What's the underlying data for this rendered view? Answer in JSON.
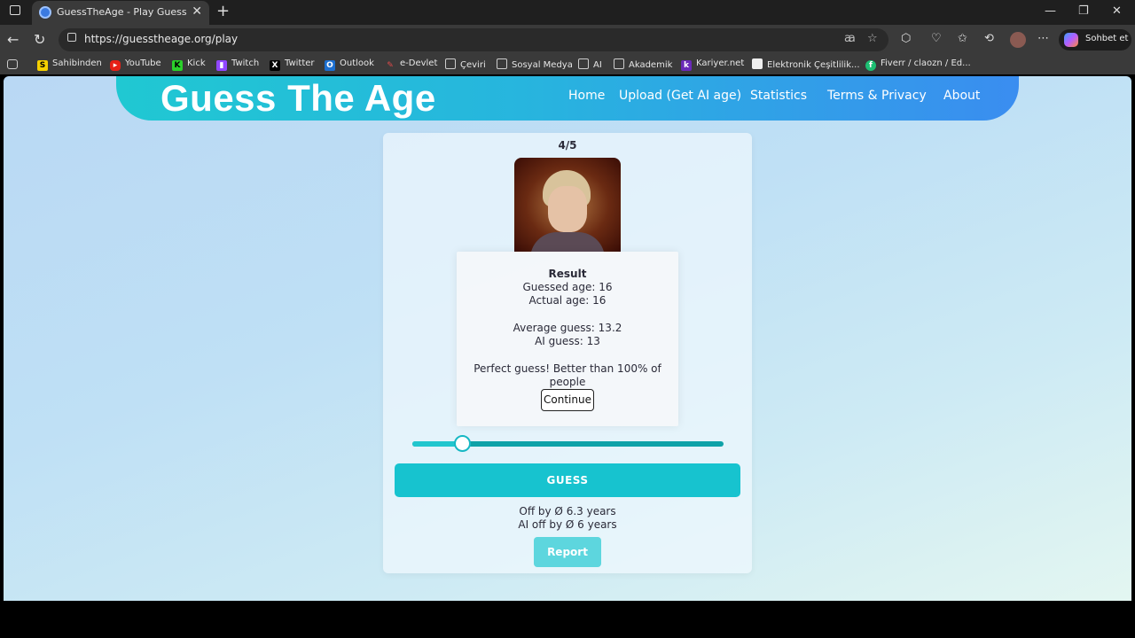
{
  "browser": {
    "tab_title": "GuessTheAge - Play Guess The Ag",
    "url": "https://guesstheage.org/play",
    "copilot_label": "Sohbet et",
    "bookmarks": [
      "Sahibinden",
      "YouTube",
      "Kick",
      "Twitch",
      "Twitter",
      "Outlook",
      "e-Devlet",
      "Çeviri",
      "Sosyal Medya",
      "AI",
      "Akademik",
      "Kariyer.net",
      "Elektronik Çeşitlilik...",
      "Fiverr / claozn / Ed..."
    ]
  },
  "site": {
    "brand": "Guess The Age",
    "nav": [
      "Home",
      "Upload (Get AI age)",
      "Statistics",
      "Terms & Privacy",
      "About"
    ]
  },
  "game": {
    "progress": "4/5",
    "result": {
      "title": "Result",
      "guessed": "Guessed age: 16",
      "actual": "Actual age: 16",
      "average": "Average guess: 13.2",
      "ai": "AI guess: 13",
      "message_line1": "Perfect guess! Better than 100% of",
      "message_line2": "people",
      "continue_label": "Continue"
    },
    "slider_fraction": 0.16,
    "guess_label": "GUESS",
    "off_by": "Off by Ø 6.3 years",
    "ai_off_by": "AI off by Ø 6 years",
    "report_label": "Report"
  },
  "colors": {
    "accent": "#17c3cf",
    "header_start": "#20c8d2",
    "header_end": "#3a8df0"
  }
}
